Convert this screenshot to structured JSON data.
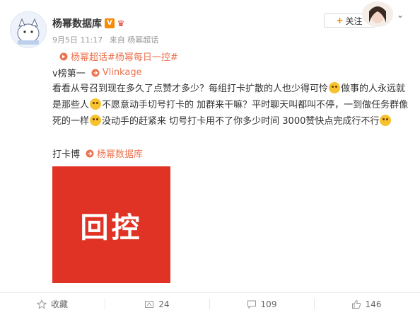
{
  "post": {
    "author": "杨幂数据库",
    "verified_badge": "V",
    "time": "9月5日 11:17",
    "source": "来自 杨幂超话",
    "topics": "杨幂超话#杨幂每日一控#",
    "line1_prefix": "v榜第一",
    "line1_link": "Vlinkage",
    "body_parts": [
      "看看从号召到现在多久了点赞才多少？每组打卡扩散的人也少得可怜",
      "做事的人永远就是那些人",
      "不愿意动手切号打卡的 加群来干嘛？平时聊天叫都叫不停，一到做任务群像死的一样",
      "没动手的赶紧来 切号打卡用不了你多少时间 3000赞快点完成行不行"
    ],
    "last_prefix": "打卡博",
    "last_link": "杨幂数据库",
    "poster_text": "回控"
  },
  "header": {
    "follow_label": "关注",
    "follow_plus": "+"
  },
  "actions": {
    "favorite": "收藏",
    "repost": "24",
    "comment": "109",
    "like": "146"
  },
  "colors": {
    "accent_link": "#eb7350",
    "follow_plus": "#ff8200",
    "poster_bg": "#e03325",
    "badge": "#f68b06"
  },
  "icons": [
    "avatar",
    "verified-icon",
    "crown-icon",
    "chevron-down-icon",
    "topic-icon",
    "link-icon",
    "emoji",
    "favorite-icon",
    "repost-icon",
    "comment-icon",
    "like-icon"
  ]
}
